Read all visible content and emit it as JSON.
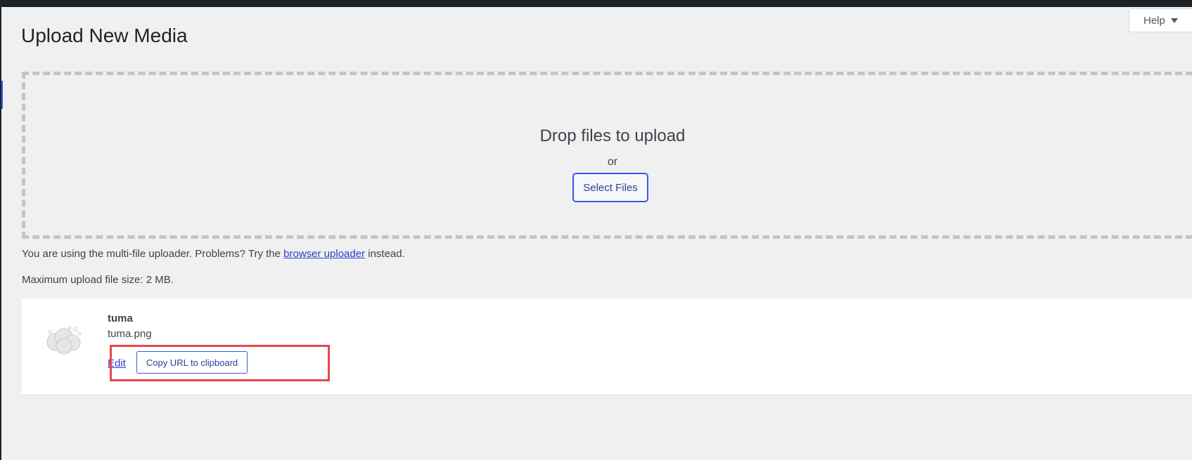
{
  "header": {
    "help_label": "Help",
    "page_title": "Upload New Media"
  },
  "dropzone": {
    "title": "Drop files to upload",
    "or": "or",
    "select_files_label": "Select Files"
  },
  "info": {
    "uploader_prefix": "You are using the multi-file uploader. Problems? Try the",
    "uploader_link": "browser uploader",
    "uploader_suffix": "instead.",
    "max_size": "Maximum upload file size: 2 MB."
  },
  "media_item": {
    "title": "tuma",
    "filename": "tuma.png",
    "edit_label": "Edit",
    "copy_url_label": "Copy URL to clipboard",
    "thumbnail_icon": "image-thumbnail-icon"
  },
  "colors": {
    "accent": "#3858e9",
    "highlight": "#e5484d",
    "background": "#f0f0f1"
  }
}
